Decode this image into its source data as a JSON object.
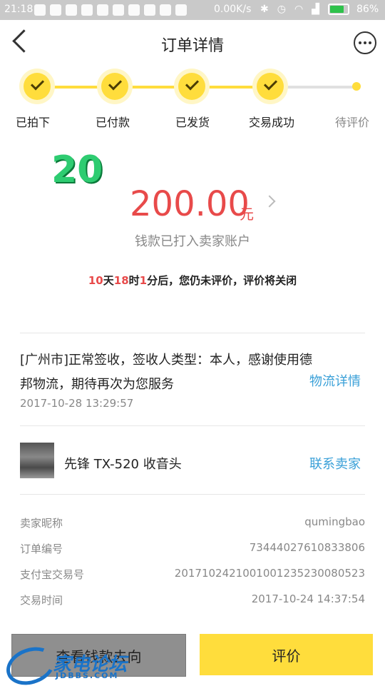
{
  "status_bar": {
    "time": "21:18",
    "speed": "0.00K/s",
    "battery_pct": "86%",
    "battery_level": 0.86
  },
  "header": {
    "title": "订单详情"
  },
  "progress": {
    "steps": [
      {
        "label": "已拍下",
        "done": true
      },
      {
        "label": "已付款",
        "done": true
      },
      {
        "label": "已发货",
        "done": true
      },
      {
        "label": "交易成功",
        "done": true
      },
      {
        "label": "待评价",
        "done": false
      }
    ],
    "accent": "#ffdd3c"
  },
  "watermark_number": "20",
  "amount": {
    "value": "200.00",
    "unit": "元",
    "note": "钱款已打入卖家账户",
    "color": "#e84a4a"
  },
  "countdown": {
    "days": "10",
    "days_unit": "天",
    "hours": "18",
    "hours_unit": "时",
    "minutes": "1",
    "rest": "分后，您仍未评价，评价将关闭"
  },
  "logistics": {
    "text": "[广州市]正常签收，签收人类型：本人，感谢使用德邦物流，期待再次为您服务",
    "time": "2017-10-28 13:29:57",
    "link": "物流详情"
  },
  "product": {
    "name": "先锋 TX-520 收音头",
    "link": "联系卖家"
  },
  "details": [
    {
      "label": "卖家昵称",
      "value": "qumingbao"
    },
    {
      "label": "订单编号",
      "value": "73444027610833806"
    },
    {
      "label": "支付宝交易号",
      "value": "2017102421001001235230080523"
    },
    {
      "label": "交易时间",
      "value": "2017-10-24 14:37:54"
    }
  ],
  "buttons": {
    "left": "查看钱款去向",
    "right": "评价"
  },
  "logo": {
    "cn": "家电论坛",
    "en": "JDBBS.COM"
  },
  "link_color": "#3aa0d8"
}
